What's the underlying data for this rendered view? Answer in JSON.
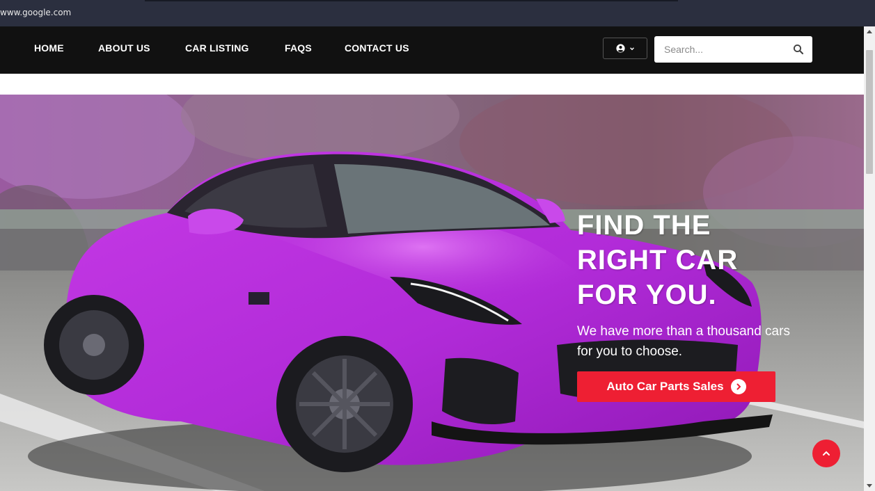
{
  "browser": {
    "url": "www.google.com"
  },
  "nav": {
    "items": [
      {
        "label": "HOME"
      },
      {
        "label": "ABOUT US"
      },
      {
        "label": "CAR LISTING"
      },
      {
        "label": "FAQS"
      },
      {
        "label": "CONTACT US"
      }
    ],
    "user_menu_icon": "user-circle-icon",
    "search": {
      "placeholder": "Search...",
      "value": "",
      "icon": "search-icon"
    }
  },
  "hero": {
    "title_line1": "FIND THE",
    "title_line2": "RIGHT CAR",
    "title_line3": "FOR YOU.",
    "subtitle": "We have more than a thousand cars for you to choose.",
    "cta_label": "Auto Car Parts Sales",
    "cta_icon": "chevron-right-circle-icon"
  },
  "colors": {
    "nav_bg": "#111111",
    "accent": "#ee1f33",
    "car": "#b12bd8"
  }
}
